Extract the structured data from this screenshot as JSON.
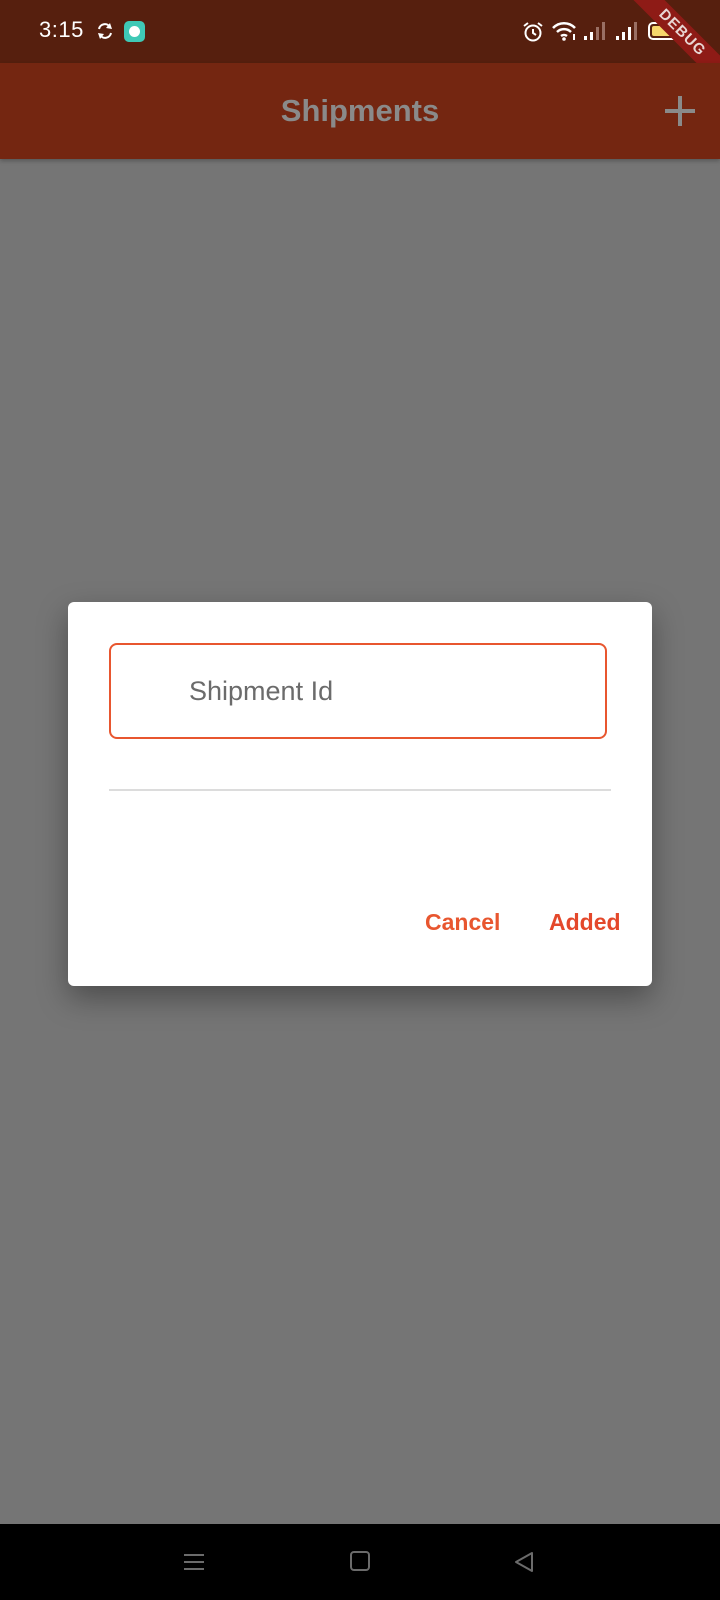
{
  "status_bar": {
    "time": "3:15",
    "icons": [
      "sync-icon",
      "app-notification-icon",
      "alarm-icon",
      "wifi-icon",
      "signal-icon",
      "signal-icon",
      "battery-icon"
    ],
    "debug_label": "DEBUG"
  },
  "app_bar": {
    "title": "Shipments",
    "action_icon": "plus-icon"
  },
  "dialog": {
    "input_placeholder": "Shipment Id",
    "input_value": "",
    "cancel_label": "Cancel",
    "confirm_label": "Added"
  },
  "nav_bar": {
    "icons": [
      "menu-icon",
      "home-icon",
      "back-icon"
    ]
  },
  "colors": {
    "status_bar": "#561f0e",
    "app_bar": "#742611",
    "scrim": "#757575",
    "accent": "#e8562f"
  }
}
